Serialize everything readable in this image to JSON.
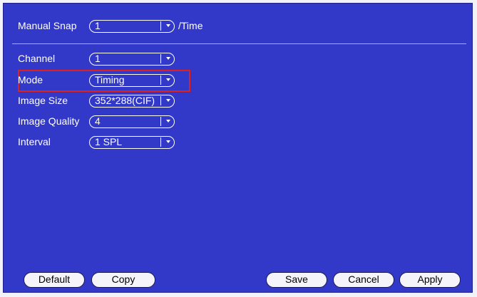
{
  "manual_snap": {
    "label": "Manual Snap",
    "value": "1",
    "suffix": "/Time"
  },
  "fields": [
    {
      "label": "Channel",
      "value": "1"
    },
    {
      "label": "Mode",
      "value": "Timing"
    },
    {
      "label": "Image Size",
      "value": "352*288(CIF)"
    },
    {
      "label": "Image Quality",
      "value": "4"
    },
    {
      "label": "Interval",
      "value": "1 SPL"
    }
  ],
  "buttons": {
    "default": "Default",
    "copy": "Copy",
    "save": "Save",
    "cancel": "Cancel",
    "apply": "Apply"
  },
  "colors": {
    "panel_bg": "#3238c8",
    "highlight_border": "#e0201a",
    "text": "#ffffff",
    "button_bg": "#f4f4fa"
  },
  "icons": {
    "dropdown_arrow": "chevron-down-icon"
  }
}
